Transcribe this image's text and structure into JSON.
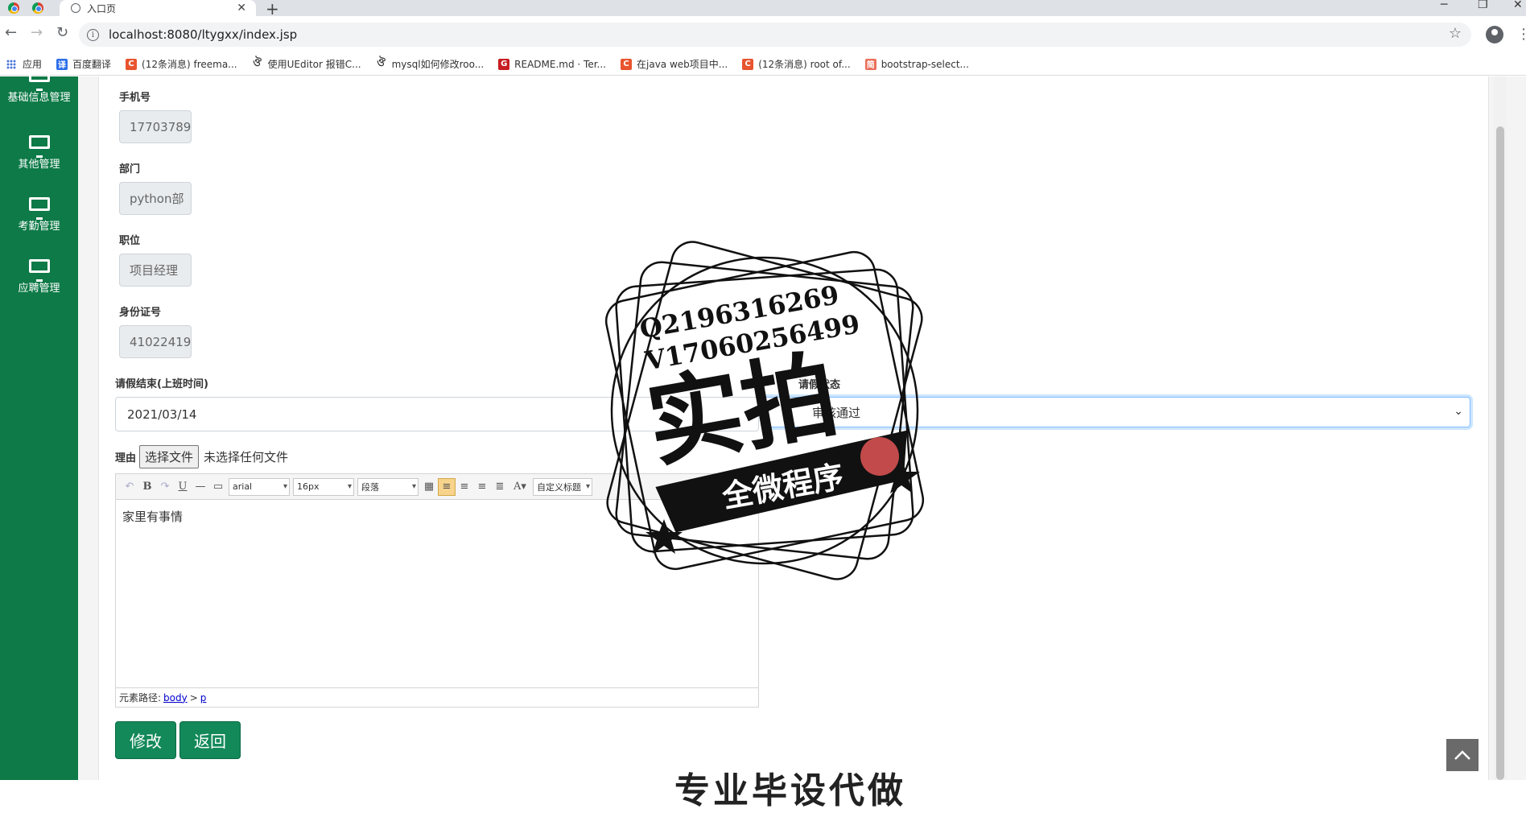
{
  "browser": {
    "tab_title": "入口页",
    "url": "localhost:8080/ltygxx/index.jsp",
    "bookmarks": [
      {
        "label": "应用",
        "icon": "apps-icon"
      },
      {
        "label": "百度翻译",
        "icon": "baidu-translate-icon",
        "color": "#2d6fe8",
        "glyph": "译"
      },
      {
        "label": "(12条消息) freema...",
        "icon": "csdn-icon",
        "color": "#e8542e",
        "glyph": "C"
      },
      {
        "label": "使用UEditor 报错C...",
        "icon": "ueditor-icon",
        "color": "#ffffff",
        "glyph": "ঔ"
      },
      {
        "label": "mysql如何修改roo...",
        "icon": "mysql-icon",
        "color": "#ffffff",
        "glyph": "ঔ"
      },
      {
        "label": "README.md · Ter...",
        "icon": "gitee-icon",
        "color": "#c71d23",
        "glyph": "G"
      },
      {
        "label": "在java web项目中...",
        "icon": "csdn-icon",
        "color": "#e8542e",
        "glyph": "C"
      },
      {
        "label": "(12条消息) root of...",
        "icon": "csdn-icon",
        "color": "#e8542e",
        "glyph": "C"
      },
      {
        "label": "bootstrap-select...",
        "icon": "jianshu-icon",
        "color": "#ea6f5a",
        "glyph": "简"
      }
    ]
  },
  "sidebar": {
    "items": [
      {
        "label": "基础信息管理",
        "icon": "monitor-icon"
      },
      {
        "label": "其他管理",
        "icon": "monitor-icon"
      },
      {
        "label": "考勤管理",
        "icon": "monitor-icon"
      },
      {
        "label": "应聘管理",
        "icon": "monitor-icon"
      }
    ]
  },
  "form": {
    "phone": {
      "label": "手机号",
      "value": "17703789"
    },
    "department": {
      "label": "部门",
      "value": "python部"
    },
    "position": {
      "label": "职位",
      "value": "项目经理"
    },
    "id_number": {
      "label": "身份证号",
      "value": "41022419"
    },
    "leave_end": {
      "label": "请假结束(上班时间)",
      "value": "2021/03/14"
    },
    "status": {
      "label": "请假状态",
      "value": "审核通过"
    },
    "reason": {
      "label": "理由",
      "file_button": "选择文件",
      "file_status": "未选择任何文件"
    },
    "editor": {
      "font_family": "arial",
      "font_size": "16px",
      "paragraph": "段落",
      "custom_title": "自定义标题",
      "content": "家里有事情",
      "path_label": "元素路径:",
      "path_body": "body",
      "path_sep": ">",
      "path_p": "p"
    },
    "edit_button": "修改",
    "back_button": "返回"
  },
  "footer_text": "专业毕设代做",
  "watermark": {
    "line1": "Q2196316269",
    "line2": "V17060256499",
    "big": "实拍",
    "banner": "全微程序"
  },
  "colors": {
    "sidebar": "#0d7a47",
    "button": "#13895a"
  }
}
